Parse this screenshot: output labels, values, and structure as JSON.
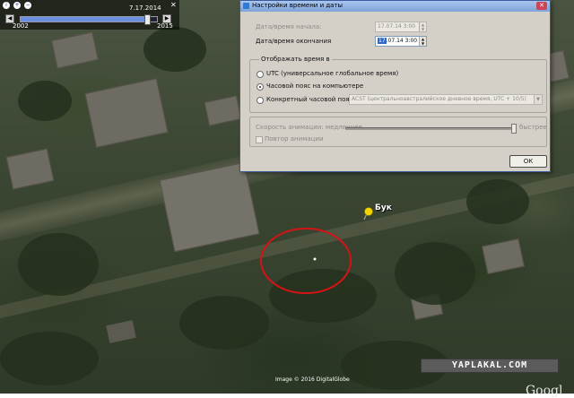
{
  "time_slider": {
    "current_date": "7.17.2014",
    "start_year": "2002",
    "end_year": "2015",
    "position_fraction": 0.93
  },
  "dialog": {
    "title": "Настройки времени и даты",
    "start_label": "Дата/время начала:",
    "start_value": "17.07.14 3:00",
    "end_label": "Дата/время окончания",
    "end_day": "17",
    "end_rest": ".07.14 3:00",
    "timezone_group": "Отображать время в",
    "option_utc": "UTC (универсальное глобальное время)",
    "option_local": "Часовой пояс на компьютере",
    "option_specific": "Конкретный часовой пояс",
    "specific_value": "ACST (центральноавстралийское дневное время, UTC + 10/5)",
    "speed_label": "Скорость анимации: медленнее",
    "speed_fast": "быстрее",
    "speed_fraction": 0.99,
    "repeat_label": "Повтор анимации",
    "ok_label": "ОК"
  },
  "placemark": {
    "label": "Бук"
  },
  "footer": {
    "attribution": "Image © 2016 DigitalGlobe",
    "watermark": "YAPLAKAL.COM",
    "logo": "Googl"
  },
  "colors": {
    "annotation_circle": "#d41414",
    "pin": "#f2d400",
    "titlebar": "#7ea2d8",
    "slider_fill": "#6a8fe0"
  },
  "icons": [
    "info-icon",
    "zoom-in-icon",
    "zoom-out-icon",
    "close-icon",
    "pushpin-icon"
  ]
}
